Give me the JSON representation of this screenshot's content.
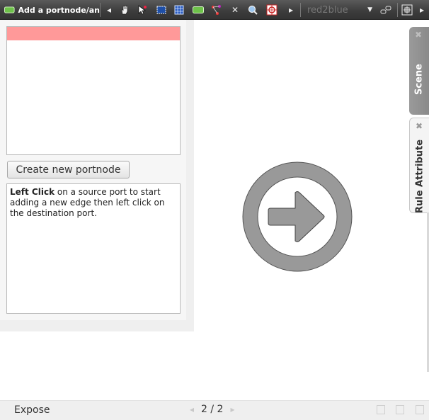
{
  "toolbar": {
    "mode_title": "Add a portnode/an",
    "combo_value": "red2blue",
    "icons": [
      "add-portnode-icon",
      "prev-arrow",
      "hand-icon",
      "select-pointer-icon",
      "marquee-select-icon",
      "grid-icon",
      "add-edge-icon",
      "node-link-icon",
      "delete-x-icon",
      "zoom-icon",
      "target-icon",
      "next-arrow",
      "combo-dropdown",
      "link-icon",
      "fit-view-icon",
      "more-arrow"
    ]
  },
  "left_panel": {
    "create_button_label": "Create new portnode",
    "help_bold": "Left Click",
    "help_text": " on a source port to start adding a new edge then left click on the destination port."
  },
  "side_tabs": {
    "scene_label": "Scene",
    "rule_attribute_label": "Rule Attribute",
    "close_glyph": "✖"
  },
  "statusbar": {
    "expose_label": "Expose",
    "page_indicator": "2 / 2"
  },
  "colors": {
    "toolbar_bg": "#3c3c3c",
    "selected_row": "#ff9999",
    "scene_tab": "#8f8f8f",
    "canvas_icon": "#999999"
  }
}
